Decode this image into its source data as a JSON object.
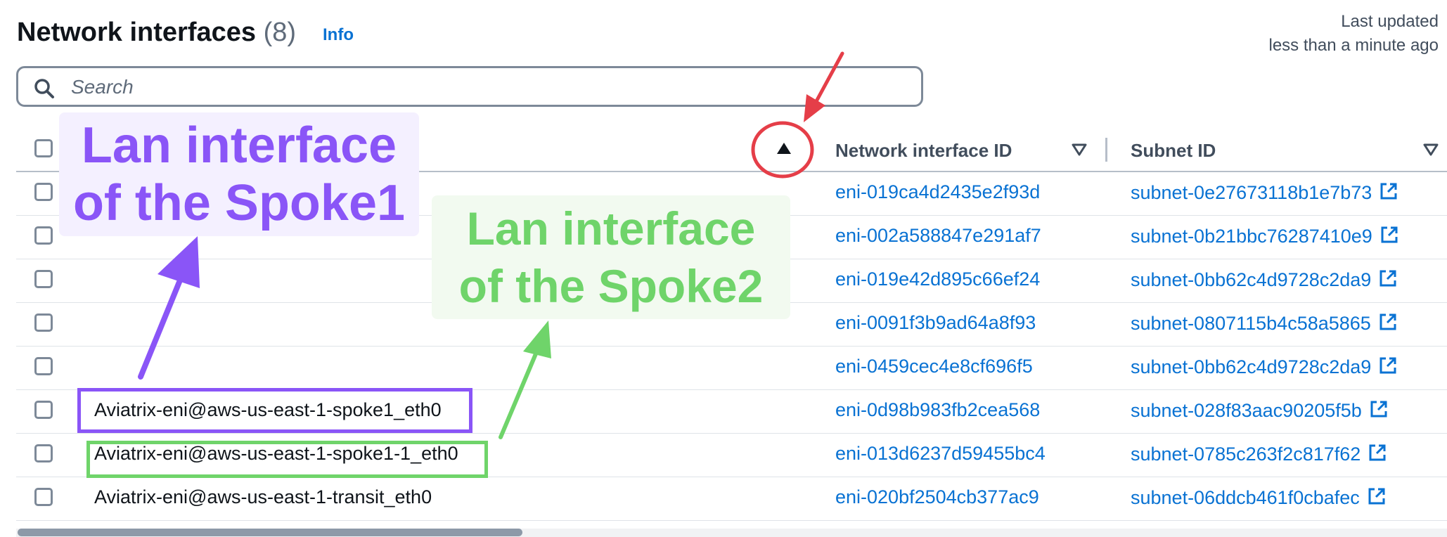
{
  "header": {
    "title": "Network interfaces",
    "count": "(8)",
    "info": "Info",
    "last_updated_label": "Last updated",
    "last_updated_value": "less than a minute ago"
  },
  "search": {
    "placeholder": "Search"
  },
  "columns": {
    "name": "",
    "network_interface_id": "Network interface ID",
    "subnet_id": "Subnet ID"
  },
  "rows": [
    {
      "name": "",
      "eni": "eni-019ca4d2435e2f93d",
      "subnet": "subnet-0e27673118b1e7b73"
    },
    {
      "name": "",
      "eni": "eni-002a588847e291af7",
      "subnet": "subnet-0b21bbc76287410e9"
    },
    {
      "name": "",
      "eni": "eni-019e42d895c66ef24",
      "subnet": "subnet-0bb62c4d9728c2da9"
    },
    {
      "name": "",
      "eni": "eni-0091f3b9ad64a8f93",
      "subnet": "subnet-0807115b4c58a5865"
    },
    {
      "name": "",
      "eni": "eni-0459cec4e8cf696f5",
      "subnet": "subnet-0bb62c4d9728c2da9"
    },
    {
      "name": "Aviatrix-eni@aws-us-east-1-spoke1_eth0",
      "eni": "eni-0d98b983fb2cea568",
      "subnet": "subnet-028f83aac90205f5b"
    },
    {
      "name": "Aviatrix-eni@aws-us-east-1-spoke1-1_eth0",
      "eni": "eni-013d6237d59455bc4",
      "subnet": "subnet-0785c263f2c817f62"
    },
    {
      "name": "Aviatrix-eni@aws-us-east-1-transit_eth0",
      "eni": "eni-020bf2504cb377ac9",
      "subnet": "subnet-06ddcb461f0cbafec"
    }
  ],
  "annotations": {
    "spoke1_line1": "Lan interface",
    "spoke1_line2": "of the Spoke1",
    "spoke2_line1": "Lan interface",
    "spoke2_line2": "of the Spoke2"
  },
  "colors": {
    "link": "#0972d3",
    "purple": "#8a55f7",
    "green": "#6fd46a",
    "red": "#e53e48"
  },
  "icons": {
    "search": "search-icon",
    "sort_asc": "caret-up-icon",
    "sort": "sort-triangle-icon",
    "external": "external-link-icon"
  }
}
